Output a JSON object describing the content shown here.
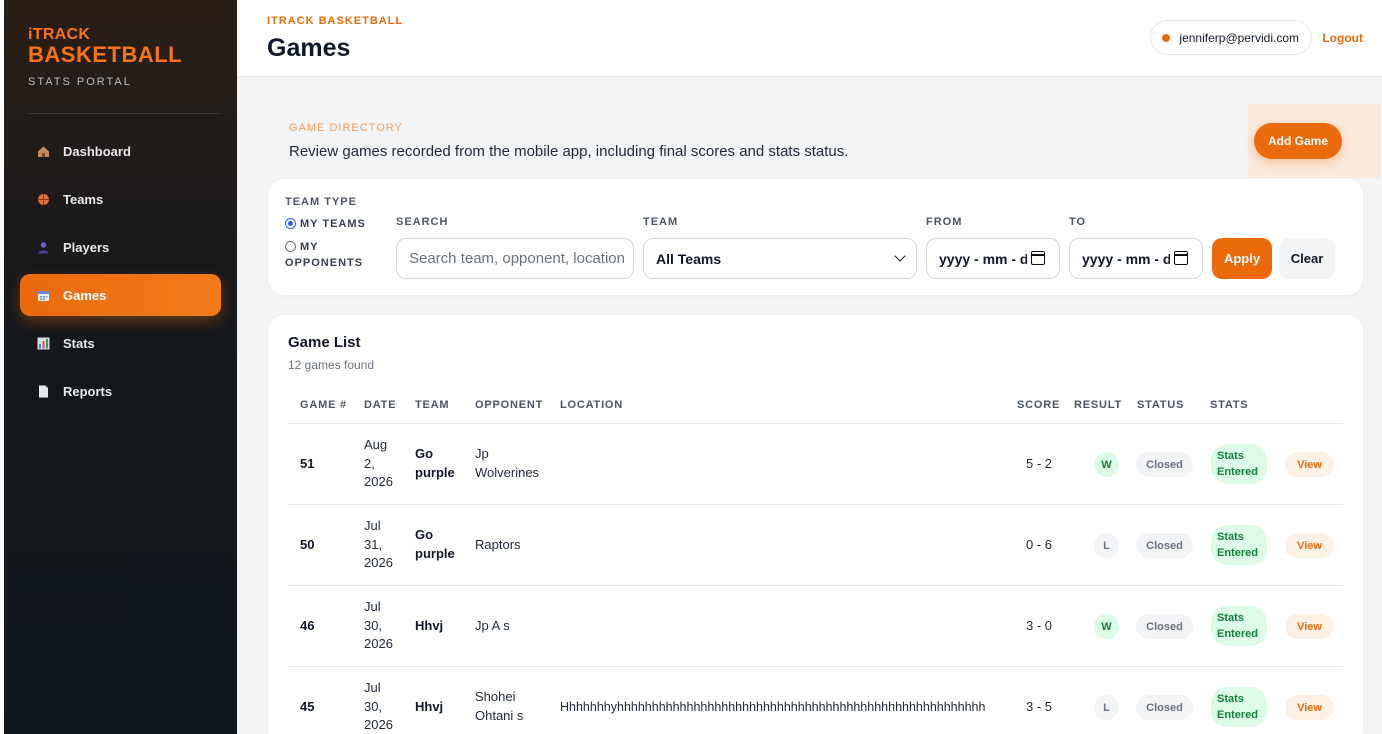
{
  "app": {
    "brand_small": "iTRACK",
    "brand_big": "BASKETBALL",
    "brand_sub": "STATS PORTAL",
    "accent": "#ea6a0c"
  },
  "sidebar": {
    "items": [
      {
        "label": "Dashboard",
        "icon": "house-icon"
      },
      {
        "label": "Teams",
        "icon": "basketball-icon"
      },
      {
        "label": "Players",
        "icon": "person-icon"
      },
      {
        "label": "Games",
        "icon": "calendar-icon",
        "active": true
      },
      {
        "label": "Stats",
        "icon": "bar-chart-icon"
      },
      {
        "label": "Reports",
        "icon": "document-icon"
      }
    ]
  },
  "header": {
    "eyebrow": "ITRACK BASKETBALL",
    "title": "Games",
    "user_email": "jenniferp@pervidi.com",
    "logout_label": "Logout"
  },
  "directory": {
    "eyebrow": "GAME DIRECTORY",
    "description": "Review games recorded from the mobile app, including final scores and stats status.",
    "add_label": "Add Game"
  },
  "filters": {
    "team_type_label": "TEAM TYPE",
    "my_teams_label": "MY TEAMS",
    "my_opponents_label_1": "MY",
    "my_opponents_label_2": "OPPONENTS",
    "selected_team_type": "MY TEAMS",
    "search_label": "SEARCH",
    "search_placeholder": "Search team, opponent, location",
    "team_label": "TEAM",
    "team_value": "All Teams",
    "from_label": "FROM",
    "from_placeholder": "yyyy - mm - dd",
    "to_label": "TO",
    "to_placeholder": "yyyy - mm - dd",
    "apply_label": "Apply",
    "clear_label": "Clear"
  },
  "list": {
    "title": "Game List",
    "count_text": "12 games found",
    "columns": [
      "GAME #",
      "DATE",
      "TEAM",
      "OPPONENT",
      "LOCATION",
      "SCORE",
      "RESULT",
      "STATUS",
      "STATS"
    ],
    "rows": [
      {
        "num": "51",
        "date": [
          "Aug",
          "2,",
          "2026"
        ],
        "team": [
          "Go",
          "purple"
        ],
        "opponent": [
          "Jp",
          "Wolverines"
        ],
        "location": "",
        "score": "5 - 2",
        "result": "W",
        "status": "Closed",
        "stats": [
          "Stats",
          "Entered"
        ],
        "action": "View"
      },
      {
        "num": "50",
        "date": [
          "Jul",
          "31,",
          "2026"
        ],
        "team": [
          "Go",
          "purple"
        ],
        "opponent": [
          "Raptors"
        ],
        "location": "",
        "score": "0 - 6",
        "result": "L",
        "status": "Closed",
        "stats": [
          "Stats",
          "Entered"
        ],
        "action": "View"
      },
      {
        "num": "46",
        "date": [
          "Jul",
          "30,",
          "2026"
        ],
        "team": [
          "Hhvj"
        ],
        "opponent": [
          "Jp A s"
        ],
        "location": "",
        "score": "3 - 0",
        "result": "W",
        "status": "Closed",
        "stats": [
          "Stats",
          "Entered"
        ],
        "action": "View"
      },
      {
        "num": "45",
        "date": [
          "Jul",
          "30,",
          "2026"
        ],
        "team": [
          "Hhvj"
        ],
        "opponent": [
          "Shohei",
          "Ohtani s"
        ],
        "location": "Hhhhhhhyhhhhhhhhhhhhhhhhhhhhhhhhhhhhhhhhhhhhhhhhhhhhhhhhhhhhh",
        "score": "3 - 5",
        "result": "L",
        "status": "Closed",
        "stats": [
          "Stats",
          "Entered"
        ],
        "action": "View"
      }
    ]
  }
}
